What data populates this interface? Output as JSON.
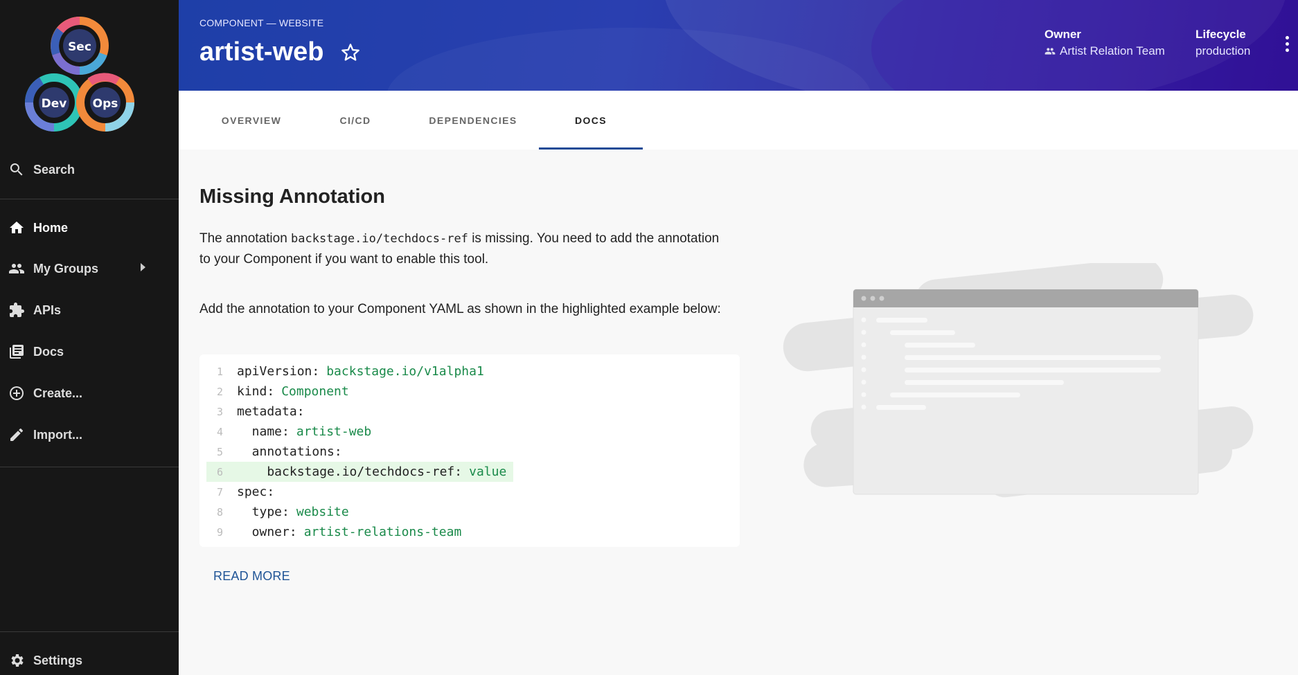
{
  "sidebar": {
    "items": [
      {
        "label": "Search",
        "icon": "search-icon"
      },
      {
        "label": "Home",
        "icon": "home-icon"
      },
      {
        "label": "My Groups",
        "icon": "groups-icon"
      },
      {
        "label": "APIs",
        "icon": "puzzle-icon"
      },
      {
        "label": "Docs",
        "icon": "docs-icon"
      },
      {
        "label": "Create...",
        "icon": "add-circle-icon"
      },
      {
        "label": "Import...",
        "icon": "pencil-icon"
      },
      {
        "label": "Settings",
        "icon": "gear-icon"
      }
    ],
    "logo": {
      "sec": "Sec",
      "dev": "Dev",
      "ops": "Ops"
    }
  },
  "header": {
    "kind": "COMPONENT — WEBSITE",
    "title": "artist-web",
    "owner_label": "Owner",
    "owner_value": "Artist Relation Team",
    "lifecycle_label": "Lifecycle",
    "lifecycle_value": "production"
  },
  "tabs": [
    {
      "label": "OVERVIEW"
    },
    {
      "label": "CI/CD"
    },
    {
      "label": "DEPENDENCIES"
    },
    {
      "label": "DOCS",
      "active": true
    }
  ],
  "main": {
    "title": "Missing Annotation",
    "para1_before": "The annotation ",
    "para1_code": "backstage.io/techdocs-ref",
    "para1_after": " is missing. You need to add the annotation to your Component if you want to enable this tool.",
    "para2": "Add the annotation to your Component YAML as shown in the highlighted example below:",
    "code": [
      {
        "n": "1",
        "key": "apiVersion:",
        "val": "backstage.io/v1alpha1"
      },
      {
        "n": "2",
        "key": "kind:",
        "val": "Component"
      },
      {
        "n": "3",
        "key": "metadata:",
        "val": ""
      },
      {
        "n": "4",
        "key": "  name:",
        "val": "artist-web"
      },
      {
        "n": "5",
        "key": "  annotations:",
        "val": ""
      },
      {
        "n": "6",
        "key": "    backstage.io/techdocs-ref:",
        "val": "value"
      },
      {
        "n": "7",
        "key": "spec:",
        "val": ""
      },
      {
        "n": "8",
        "key": "  type:",
        "val": "website"
      },
      {
        "n": "9",
        "key": "  owner:",
        "val": "artist-relations-team"
      }
    ],
    "read_more": "READ MORE"
  }
}
